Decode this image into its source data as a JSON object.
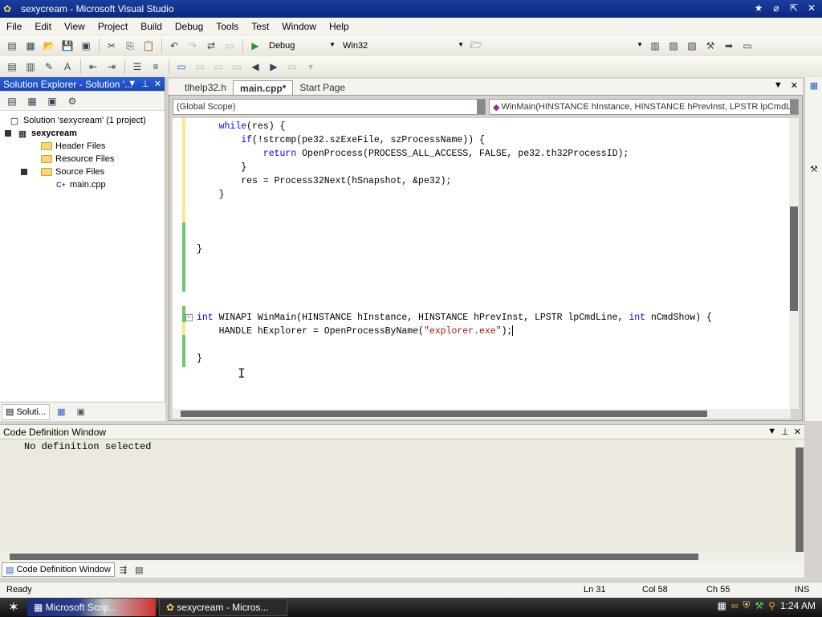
{
  "window": {
    "title": "sexycream - Microsoft Visual Studio",
    "controls": [
      "restore-icon",
      "minimize-icon",
      "maximize-icon",
      "close-icon"
    ]
  },
  "menu": [
    "File",
    "Edit",
    "View",
    "Project",
    "Build",
    "Debug",
    "Tools",
    "Test",
    "Window",
    "Help"
  ],
  "toolbar": {
    "config": "Debug",
    "platform": "Win32"
  },
  "solution_explorer": {
    "title": "Solution Explorer - Solution '...",
    "items": [
      {
        "label": "Solution 'sexycream' (1 project)"
      },
      {
        "label": "sexycream"
      },
      {
        "label": "Header Files"
      },
      {
        "label": "Resource Files"
      },
      {
        "label": "Source Files"
      },
      {
        "label": "main.cpp"
      }
    ],
    "bottom_tabs": [
      "Soluti..."
    ]
  },
  "document_tabs": [
    {
      "label": "tlhelp32.h",
      "active": false
    },
    {
      "label": "main.cpp*",
      "active": true
    },
    {
      "label": "Start Page",
      "active": false
    }
  ],
  "editor": {
    "scope": "(Global Scope)",
    "member": "WinMain(HINSTANCE hInstance, HINSTANCE hPrevInst, LPSTR lpCmdLine",
    "lines": [
      "    while(res) {",
      "        if(!strcmp(pe32.szExeFile, szProcessName)) {",
      "            return OpenProcess(PROCESS_ALL_ACCESS, FALSE, pe32.th32ProcessID);",
      "        }",
      "        res = Process32Next(hSnapshot, &pe32);",
      "    }",
      "",
      "",
      "",
      "}",
      "",
      "",
      "",
      "",
      "int WINAPI WinMain(HINSTANCE hInstance, HINSTANCE hPrevInst, LPSTR lpCmdLine, int nCmdShow) {",
      "    HANDLE hExplorer = OpenProcessByName(\"explorer.exe\");",
      "",
      "}"
    ]
  },
  "code_definition": {
    "title": "Code Definition Window",
    "text": "No definition selected",
    "tabs": [
      "Code Definition Window"
    ]
  },
  "status": {
    "ready": "Ready",
    "ln": "Ln 31",
    "col": "Col 58",
    "ch": "Ch 55",
    "ins": "INS"
  },
  "taskbar": {
    "buttons": [
      "Microsoft Scrip...",
      "sexycream - Micros..."
    ],
    "clock": "1:24 AM"
  }
}
